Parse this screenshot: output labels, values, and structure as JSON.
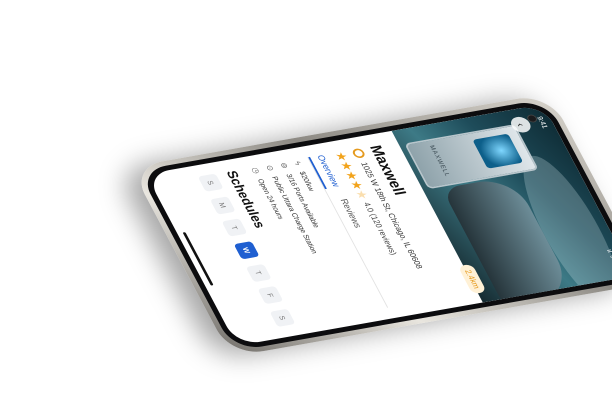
{
  "status_bar": {
    "time": "9:41",
    "right": "ıl ᯤ ▭"
  },
  "hero": {
    "charger_brand": "MAXWELL",
    "distance": "2.4km"
  },
  "station": {
    "name": "Maxwell",
    "address": "1025 W 18th St, Chicago, IL 60608",
    "rating_text": "4.0 (120 reviews)",
    "rating": 4
  },
  "tabs": [
    {
      "label": "Overview",
      "active": true
    },
    {
      "label": "Reviews",
      "active": false
    }
  ],
  "info": [
    {
      "icon": "bolt-icon",
      "text": "$20/kw"
    },
    {
      "icon": "plug-icon",
      "text": "3/16 Ports Available"
    },
    {
      "icon": "station-icon",
      "text": "Public Uttara Charge Station"
    },
    {
      "icon": "clock-icon",
      "text": "Open 24 hours"
    }
  ],
  "schedules": {
    "title": "Schedules",
    "days": [
      {
        "label": "S",
        "active": false
      },
      {
        "label": "M",
        "active": false
      },
      {
        "label": "T",
        "active": false
      },
      {
        "label": "W",
        "active": true
      },
      {
        "label": "T",
        "active": false
      },
      {
        "label": "F",
        "active": false
      },
      {
        "label": "S",
        "active": false
      }
    ]
  },
  "colors": {
    "accent": "#1f5fd1",
    "badge": "#e59a1e",
    "star": "#f2a31b"
  }
}
